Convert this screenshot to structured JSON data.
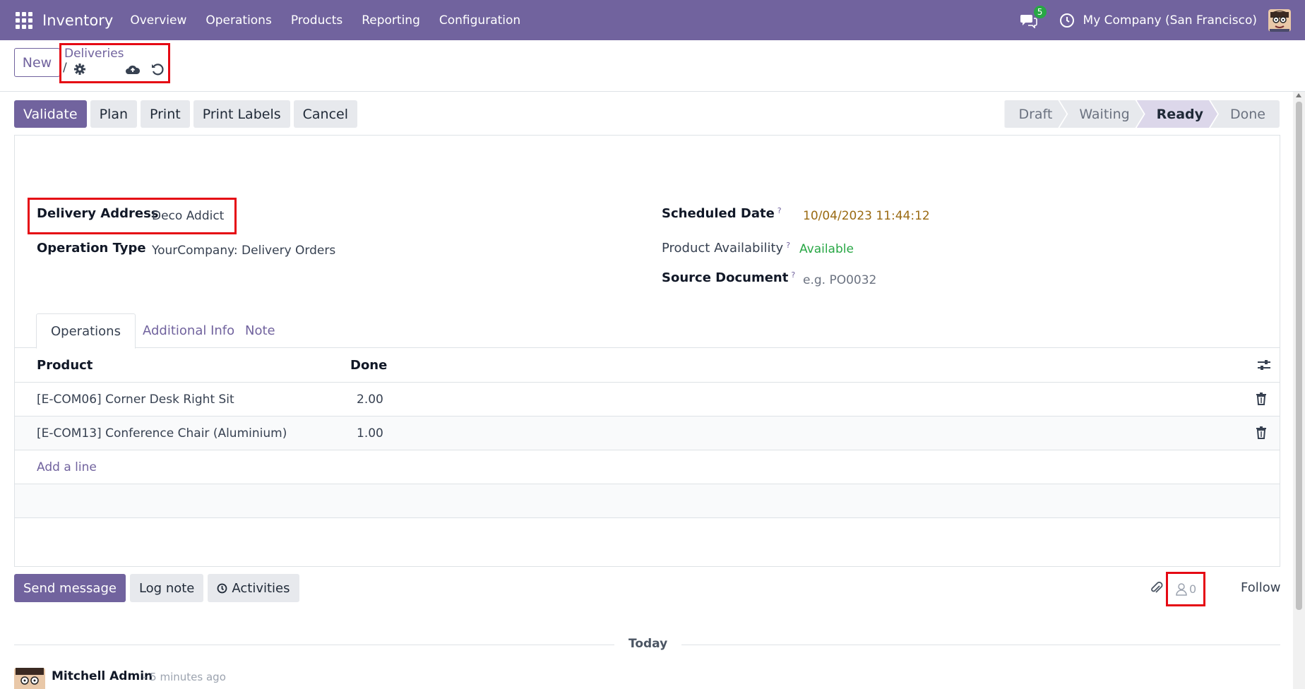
{
  "navbar": {
    "app_name": "Inventory",
    "menu": [
      "Overview",
      "Operations",
      "Products",
      "Reporting",
      "Configuration"
    ],
    "chat_count": "5",
    "company": "My Company (San Francisco)",
    "bg_color": "#71639e"
  },
  "control": {
    "new_label": "New",
    "breadcrumb": "Deliveries",
    "breadcrumb_sep": "/"
  },
  "actions": {
    "validate": "Validate",
    "plan": "Plan",
    "print": "Print",
    "print_labels": "Print Labels",
    "cancel": "Cancel"
  },
  "status": {
    "stages": [
      "Draft",
      "Waiting",
      "Ready",
      "Done"
    ],
    "current": "Ready"
  },
  "form": {
    "delivery_address_label": "Delivery Address",
    "delivery_address_value": "Deco Addict",
    "operation_type_label": "Operation Type",
    "operation_type_value": "YourCompany: Delivery Orders",
    "scheduled_date_label": "Scheduled Date",
    "scheduled_date_value": "10/04/2023 11:44:12",
    "availability_label": "Product Availability",
    "availability_value": "Available",
    "source_doc_label": "Source Document",
    "source_doc_placeholder": "e.g. PO0032",
    "help_mark": "?"
  },
  "tabs": [
    "Operations",
    "Additional Info",
    "Note"
  ],
  "grid": {
    "headers": {
      "product": "Product",
      "done": "Done"
    },
    "rows": [
      {
        "product": "[E-COM06] Corner Desk Right Sit",
        "done": "2.00"
      },
      {
        "product": "[E-COM13] Conference Chair (Aluminium)",
        "done": "1.00"
      }
    ],
    "add_line": "Add a line"
  },
  "chatter": {
    "send_message": "Send message",
    "log_note": "Log note",
    "activities": "Activities",
    "followers_count": "0",
    "follow": "Follow",
    "today": "Today",
    "author": "Mitchell Admin",
    "time": "- 5 minutes ago"
  }
}
